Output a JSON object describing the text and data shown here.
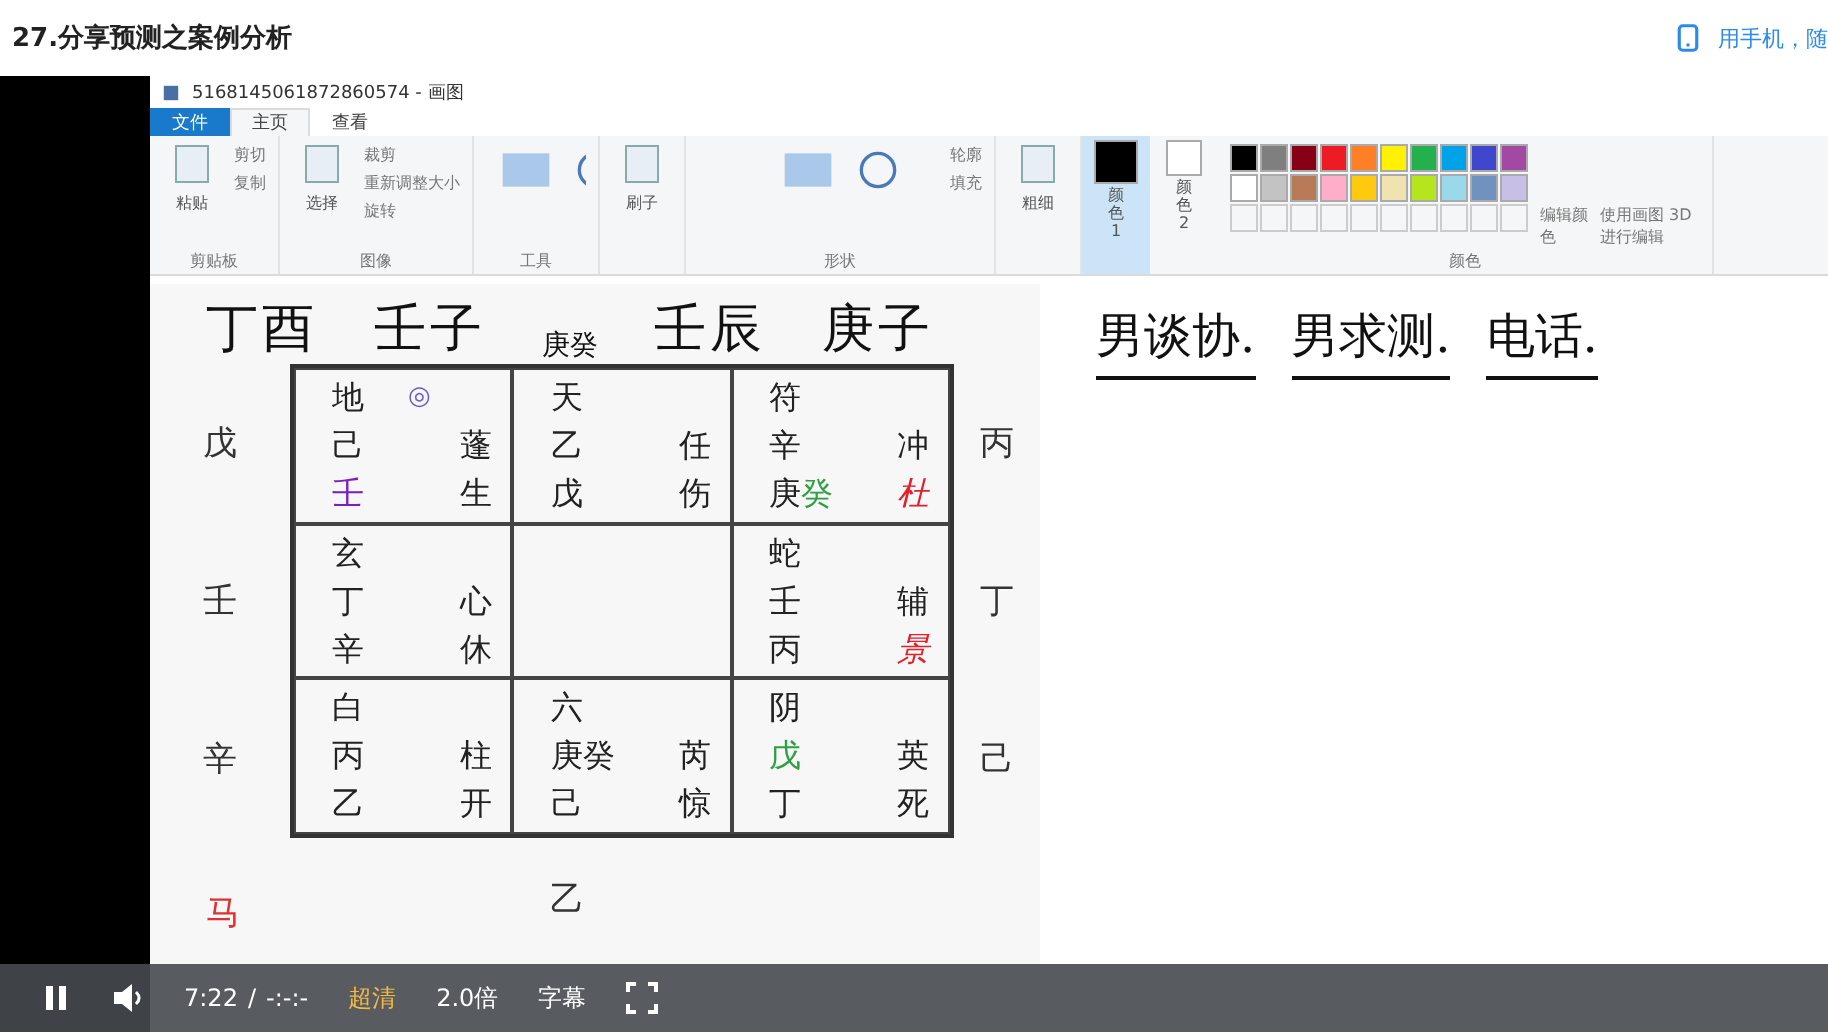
{
  "page": {
    "title": "27.分享预测之案例分析",
    "mobile_link": "用手机，随"
  },
  "paint": {
    "title": "5168145061872860574 - 画图",
    "tabs": [
      {
        "label": "文件",
        "selected": false,
        "kind": "file"
      },
      {
        "label": "主页",
        "selected": true,
        "kind": "tab"
      },
      {
        "label": "查看",
        "selected": false,
        "kind": "tab"
      }
    ],
    "groups": [
      {
        "label": "剪贴板",
        "big": "粘贴",
        "small": [
          "剪切",
          "复制"
        ]
      },
      {
        "label": "图像",
        "big": "选择",
        "small": [
          "裁剪",
          "重新调整大小",
          "旋转"
        ]
      },
      {
        "label": "工具"
      },
      {
        "big": "刷子"
      },
      {
        "label": "形状",
        "small": [
          "轮廓",
          "填充"
        ]
      },
      {
        "big": "粗细"
      }
    ],
    "color1": {
      "label": "颜色 1",
      "selected": true
    },
    "color2": {
      "label": "颜色 2",
      "selected": false
    },
    "palette": [
      {
        "color": "#000000"
      },
      {
        "color": "#7f7f7f"
      },
      {
        "color": "#880015"
      },
      {
        "color": "#ed1c24"
      },
      {
        "color": "#ff7f27"
      },
      {
        "color": "#fff200"
      },
      {
        "color": "#22b14c"
      },
      {
        "color": "#00a2e8"
      },
      {
        "color": "#3f48cc"
      },
      {
        "color": "#a349a4"
      },
      {
        "color": "#ffffff"
      },
      {
        "color": "#c3c3c3"
      },
      {
        "color": "#b97a57"
      },
      {
        "color": "#ffaec9"
      },
      {
        "color": "#ffc90e"
      },
      {
        "color": "#efe4b0"
      },
      {
        "color": "#b5e61d"
      },
      {
        "color": "#99d9ea"
      },
      {
        "color": "#7092be"
      },
      {
        "color": "#c8bfe7"
      }
    ],
    "colors_label": "颜色",
    "edit_colors": "编辑颜色",
    "paint3d": "使用画图 3D 进行编辑"
  },
  "canvas": {
    "top": [
      {
        "text": "丁酉",
        "kind": "hand"
      },
      {
        "text": "壬子",
        "kind": "hand"
      },
      {
        "text": "庚癸",
        "kind": "print"
      },
      {
        "text": "壬辰",
        "kind": "hand"
      },
      {
        "text": "庚子",
        "kind": "hand"
      }
    ],
    "left": [
      "戊",
      "壬",
      "辛"
    ],
    "right": [
      "丙",
      "丁",
      "己"
    ],
    "bottom": "乙",
    "horse": "马",
    "notes": [
      "男谈协.",
      "男求测.",
      "电话."
    ],
    "cells": [
      {
        "head": "地",
        "mark": "◎",
        "rows": [
          [
            [
              {
                "text": "己"
              }
            ],
            [
              {
                "text": "蓬"
              }
            ]
          ],
          [
            [
              {
                "text": "壬",
                "color": "#7a1fc0"
              }
            ],
            [
              {
                "text": "生"
              }
            ]
          ]
        ]
      },
      {
        "head": "天",
        "rows": [
          [
            [
              {
                "text": "乙"
              }
            ],
            [
              {
                "text": "任"
              }
            ]
          ],
          [
            [
              {
                "text": "戊"
              }
            ],
            [
              {
                "text": "伤"
              }
            ]
          ]
        ]
      },
      {
        "head": "符",
        "rows": [
          [
            [
              {
                "text": "辛"
              }
            ],
            [
              {
                "text": "冲"
              }
            ]
          ],
          [
            [
              {
                "text": "庚"
              },
              {
                "text": "癸",
                "color": "#2ea043"
              }
            ],
            [
              {
                "text": "杜",
                "color": "#e0202a",
                "italic": true
              }
            ]
          ]
        ]
      },
      {
        "head": "玄",
        "rows": [
          [
            [
              {
                "text": "丁"
              }
            ],
            [
              {
                "text": "心"
              }
            ]
          ],
          [
            [
              {
                "text": "辛"
              }
            ],
            [
              {
                "text": "休"
              }
            ]
          ]
        ]
      },
      {},
      {
        "head": "蛇",
        "rows": [
          [
            [
              {
                "text": "壬"
              }
            ],
            [
              {
                "text": "辅"
              }
            ]
          ],
          [
            [
              {
                "text": "丙"
              }
            ],
            [
              {
                "text": "景",
                "color": "#e0202a",
                "italic": true
              }
            ]
          ]
        ]
      },
      {
        "head": "白",
        "rows": [
          [
            [
              {
                "text": "丙"
              }
            ],
            [
              {
                "text": "柱"
              }
            ]
          ],
          [
            [
              {
                "text": "乙"
              }
            ],
            [
              {
                "text": "开"
              }
            ]
          ]
        ]
      },
      {
        "head": "六",
        "rows": [
          [
            [
              {
                "text": "庚癸"
              }
            ],
            [
              {
                "text": "芮"
              }
            ]
          ],
          [
            [
              {
                "text": "己"
              }
            ],
            [
              {
                "text": "惊"
              }
            ]
          ]
        ]
      },
      {
        "head": "阴",
        "rows": [
          [
            [
              {
                "text": "戊",
                "color": "#2ea043"
              }
            ],
            [
              {
                "text": "英"
              }
            ]
          ],
          [
            [
              {
                "text": "丁"
              }
            ],
            [
              {
                "text": "死"
              }
            ]
          ]
        ]
      }
    ]
  },
  "player": {
    "playing": true,
    "time": "7:22",
    "sep": "/",
    "duration": "-:-:-",
    "quality": "超清",
    "speed": "2.0倍",
    "subtitles": "字幕"
  }
}
